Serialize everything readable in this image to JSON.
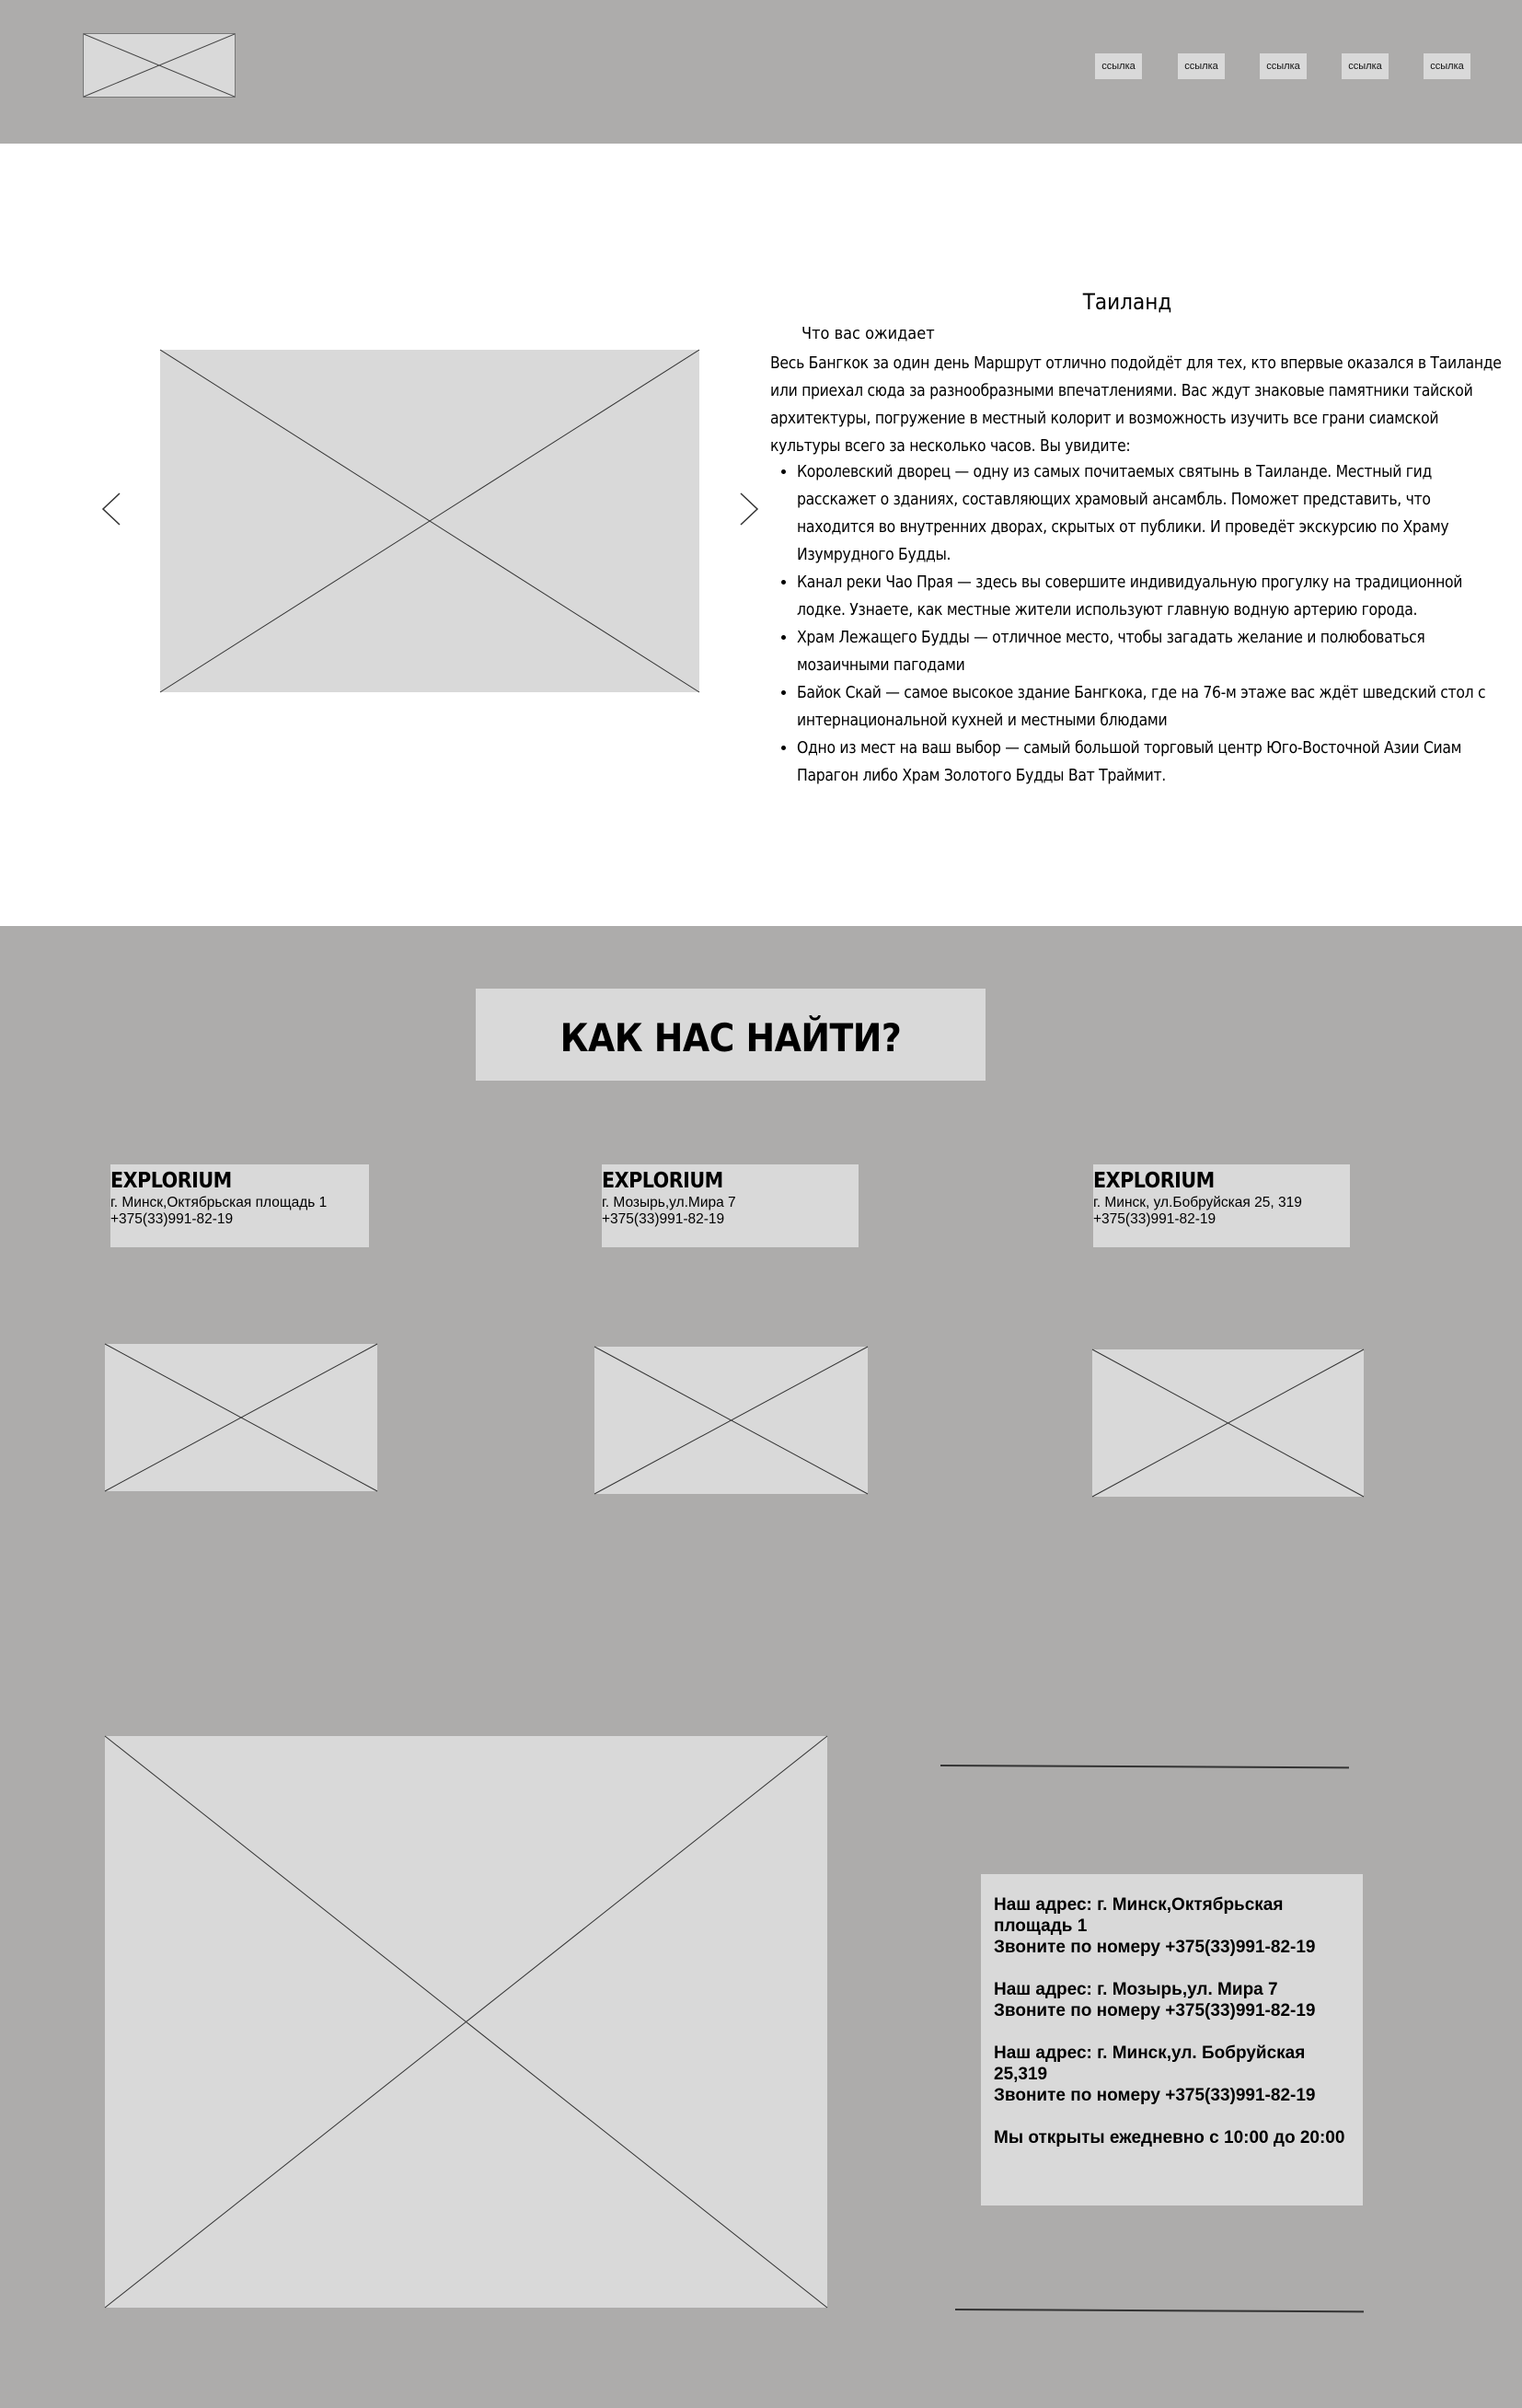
{
  "header": {
    "nav_links": [
      "ссылка",
      "ссылка",
      "ссылка",
      "ссылка",
      "ссылка"
    ]
  },
  "tour": {
    "title": "Таиланд",
    "subtitle": "Что вас ожидает",
    "intro": "Весь Бангкок за один день Маршрут отлично подойдёт для тех, кто впервые оказался в Таиланде или приехал сюда за разнообразными впечатлениями. Вас ждут знаковые памятники тайской архитектуры, погружение в местный колорит и возможность изучить все грани сиамской культуры всего за несколько часов. Вы увидите:",
    "items": [
      "Королевский дворец — одну из самых почитаемых святынь в Таиланде. Местный гид расскажет о зданиях, составляющих храмовый ансамбль. Поможет представить, что находится во внутренних дворах, скрытых от публики. И проведёт экскурсию по Храму Изумрудного Будды.",
      "Канал реки Чао Прая — здесь вы совершите индивидуальную прогулку на традиционной лодке. Узнаете, как местные жители используют главную водную артерию города.",
      "Храм Лежащего Будды — отличное место, чтобы загадать желание и полюбоваться мозаичными пагодами",
      "Байок Скай — самое высокое здание Бангкока, где на 76-м этаже вас ждёт шведский стол с интернациональной кухней и местными блюдами",
      "Одно из мест на ваш выбор — самый большой торговый центр Юго-Восточной Азии Сиам Парагон либо Храм Золотого Будды Ват Траймит."
    ]
  },
  "contacts": {
    "heading": "КАК НАС НАЙТИ?",
    "offices": [
      {
        "brand": "EXPLORIUM",
        "address": "г. Минск,Октябрьская площадь 1",
        "phone": "+375(33)991-82-19"
      },
      {
        "brand": "EXPLORIUM",
        "address": "г. Мозырь,ул.Мира 7",
        "phone": "+375(33)991-82-19"
      },
      {
        "brand": "EXPLORIUM",
        "address": "г. Минск, ул.Бобруйская 25, 319",
        "phone": "+375(33)991-82-19"
      }
    ],
    "info": [
      [
        "Наш адрес: г. Минск,Октябрьская площадь 1",
        "Звоните по номеру +375(33)991-82-19"
      ],
      [
        "Наш адрес: г. Мозырь,ул. Мира 7",
        "Звоните по номеру +375(33)991-82-19"
      ],
      [
        "Наш адрес: г. Минск,ул. Бобруйская 25,319",
        "Звоните по номеру +375(33)991-82-19"
      ],
      [
        "Мы открыты ежедневно с 10:00 до 20:00"
      ]
    ]
  },
  "colors": {
    "band": "#adacab",
    "placeholder": "#d9d9d9",
    "background": "#ffffff"
  }
}
